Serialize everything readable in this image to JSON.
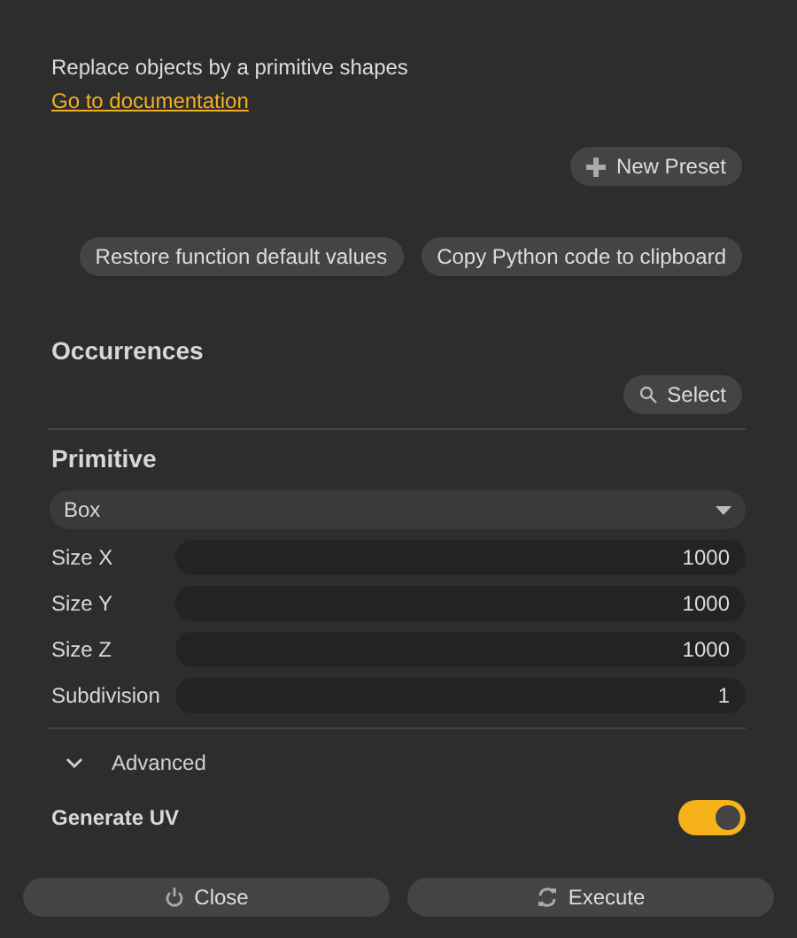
{
  "description": "Replace objects by a primitive shapes",
  "documentation_link": "Go to documentation",
  "new_preset_button": {
    "label": "New Preset"
  },
  "action_buttons": [
    "Restore function default values",
    "Copy Python code to clipboard"
  ],
  "occurrences": {
    "title": "Occurrences",
    "select_button": "Select"
  },
  "primitive": {
    "title": "Primitive",
    "dropdown": {
      "value": "Box"
    },
    "fields": [
      {
        "label": "Size X",
        "value": "1000"
      },
      {
        "label": "Size Y",
        "value": "1000"
      },
      {
        "label": "Size Z",
        "value": "1000"
      },
      {
        "label": "Subdivision",
        "value": "1"
      }
    ]
  },
  "advanced": {
    "label": "Advanced",
    "expanded": false
  },
  "generate_uv": {
    "label": "Generate UV",
    "on": true
  },
  "footer_buttons": [
    {
      "kind": "close",
      "label": "Close"
    },
    {
      "kind": "execute",
      "label": "Execute"
    }
  ]
}
